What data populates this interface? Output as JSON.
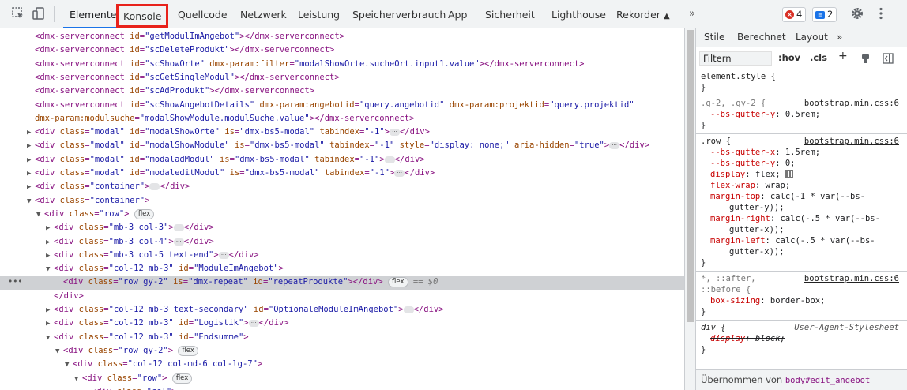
{
  "toolbar": {
    "tabs": [
      "Elemente",
      "Konsole",
      "Quellcode",
      "Netzwerk",
      "Leistung",
      "Speicherverbrauch",
      "App",
      "Sicherheit",
      "Lighthouse",
      "Rekorder"
    ],
    "more": "»",
    "errors_count": "4",
    "messages_count": "2",
    "accent": "#1a73e8",
    "highlight_color": "#e8221b"
  },
  "dom": {
    "lines": [
      {
        "i": 0,
        "html": "<dmx-serverconnect id=\"getModulImAngebot\"></dmx-serverconnect>"
      },
      {
        "i": 0,
        "html": "<dmx-serverconnect id=\"scDeleteProdukt\"></dmx-serverconnect>"
      },
      {
        "i": 0,
        "html": "<dmx-serverconnect id=\"scShowOrte\" dmx-param:filter=\"modalShowOrte.sucheOrt.input1.value\"></dmx-serverconnect>"
      },
      {
        "i": 0,
        "html": "<dmx-serverconnect id=\"scGetSingleModul\"></dmx-serverconnect>"
      },
      {
        "i": 0,
        "html": "<dmx-serverconnect id=\"scAdProdukt\"></dmx-serverconnect>"
      },
      {
        "i": 0,
        "html": "<dmx-serverconnect id=\"scShowAngebotDetails\" dmx-param:angebotid=\"query.angebotid\" dmx-param:projektid=\"query.projektid\""
      },
      {
        "i": 0,
        "html": "dmx-param:modulsuche=\"modalShowModule.modulSuche.value\"></dmx-serverconnect>"
      },
      {
        "i": 0,
        "tri": "▶",
        "html": "<div class=\"modal\" id=\"modalShowOrte\" is=\"dmx-bs5-modal\" tabindex=\"-1\">",
        "ell": true,
        "tail": "</div>"
      },
      {
        "i": 0,
        "tri": "▶",
        "html": "<div class=\"modal\" id=\"modalShowModule\" is=\"dmx-bs5-modal\" tabindex=\"-1\" style=\"display: none;\" aria-hidden=\"true\">",
        "ell": true,
        "tail": "</div>"
      },
      {
        "i": 0,
        "tri": "▶",
        "html": "<div class=\"modal\" id=\"modaladModul\" is=\"dmx-bs5-modal\" tabindex=\"-1\">",
        "ell": true,
        "tail": "</div>"
      },
      {
        "i": 0,
        "tri": "▶",
        "html": "<div class=\"modal\" id=\"modaleditModul\" is=\"dmx-bs5-modal\" tabindex=\"-1\">",
        "ell": true,
        "tail": "</div>"
      },
      {
        "i": 0,
        "tri": "▶",
        "html": "<div class=\"container\">",
        "ell": true,
        "tail": "</div>"
      },
      {
        "i": 0,
        "tri": "▼",
        "html": "<div class=\"container\">"
      },
      {
        "i": 1,
        "tri": "▼",
        "html": "<div class=\"row\">",
        "pill": "flex"
      },
      {
        "i": 2,
        "tri": "▶",
        "html": "<div class=\"mb-3 col-3\">",
        "ell": true,
        "tail": "</div>"
      },
      {
        "i": 2,
        "tri": "▶",
        "html": "<div class=\"mb-3 col-4\">",
        "ell": true,
        "tail": "</div>"
      },
      {
        "i": 2,
        "tri": "▶",
        "html": "<div class=\"mb-3 col-5 text-end\">",
        "ell": true,
        "tail": "</div>"
      },
      {
        "i": 2,
        "tri": "▼",
        "html": "<div class=\"col-12 mb-3\" id=\"ModuleImAngebot\">"
      },
      {
        "i": 3,
        "sel": true,
        "html": "<div class=\"row gy-2\" is=\"dmx-repeat\" id=\"repeatProdukte\"></div>",
        "pill": "flex",
        "eq": "== $0"
      },
      {
        "i": 2,
        "html": "</div>"
      },
      {
        "i": 2,
        "tri": "▶",
        "html": "<div class=\"col-12 mb-3 text-secondary\" id=\"OptionaleModuleImAngebot\">",
        "ell": true,
        "tail": "</div>"
      },
      {
        "i": 2,
        "tri": "▶",
        "html": "<div class=\"col-12 mb-3\" id=\"Logistik\">",
        "ell": true,
        "tail": "</div>"
      },
      {
        "i": 2,
        "tri": "▼",
        "html": "<div class=\"col-12 mb-3\" id=\"Endsumme\">"
      },
      {
        "i": 3,
        "tri": "▼",
        "html": "<div class=\"row gy-2\">",
        "pill": "flex"
      },
      {
        "i": 4,
        "tri": "▼",
        "html": "<div class=\"col-12 col-md-6 col-lg-7\">"
      },
      {
        "i": 5,
        "tri": "▼",
        "html": "<div class=\"row\">",
        "pill": "flex"
      },
      {
        "i": 6,
        "tri": "▼",
        "html": "<div class=\"col\">"
      }
    ],
    "row_dots": "•••"
  },
  "styles": {
    "tabs": [
      "Stile",
      "Berechnet",
      "Layout"
    ],
    "more": "»",
    "filter_placeholder": "Filtern",
    "hov": ":hov",
    "cls": ".cls",
    "plus": "+",
    "element_style": "element.style {",
    "close_brace": "}",
    "rule_gutter": {
      "selector": ".g-2, .gy-2 {",
      "source": "bootstrap.min.css:6",
      "decls": [
        {
          "n": "--bs-gutter-y",
          "v": "0.5rem;"
        }
      ]
    },
    "rule_row": {
      "selector": ".row {",
      "source": "bootstrap.min.css:6",
      "decls": [
        {
          "n": "--bs-gutter-x",
          "v": "1.5rem;"
        },
        {
          "n": "--bs-gutter-y",
          "v": "0;",
          "strike": true
        },
        {
          "n": "display",
          "v": "flex;",
          "icon": true
        },
        {
          "n": "flex-wrap",
          "v": "wrap;"
        },
        {
          "n": "margin-top",
          "v": "calc(-1 * var(--bs-",
          "cont": "gutter-y));"
        },
        {
          "n": "margin-right",
          "v": "calc(-.5 * var(--bs-",
          "cont": "gutter-x));"
        },
        {
          "n": "margin-left",
          "v": "calc(-.5 * var(--bs-",
          "cont": "gutter-x));"
        }
      ]
    },
    "rule_universal": {
      "selector1": "*, ::after,",
      "selector2": "::before {",
      "source": "bootstrap.min.css:6",
      "decls": [
        {
          "n": "box-sizing",
          "v": "border-box;"
        }
      ]
    },
    "rule_div": {
      "selector": "div {",
      "source": "User-Agent-Stylesheet",
      "decls": [
        {
          "n": "display",
          "v": "block;",
          "strike": true
        }
      ]
    },
    "inherited_prefix": "Übernommen von",
    "inherited_from": "body#edit_angebot"
  }
}
